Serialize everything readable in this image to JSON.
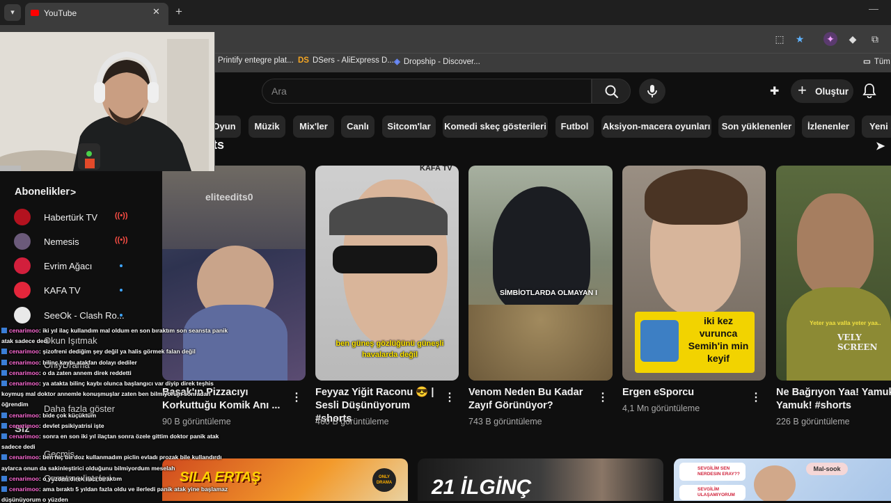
{
  "browser": {
    "tab_title": "YouTube",
    "tab_close": "✕",
    "new_tab": "+",
    "minimize": "—",
    "bookmarks": [
      {
        "icon": "",
        "label": "Printify entegre plat..."
      },
      {
        "icon": "DS",
        "label": "DSers - AliExpress D..."
      },
      {
        "icon": "◈",
        "label": "Dropship - Discover..."
      },
      {
        "icon": "▭",
        "label": "Tüm"
      }
    ]
  },
  "header": {
    "search_placeholder": "Ara",
    "create_label": "Oluştur"
  },
  "chips": [
    "Oyun",
    "Müzik",
    "Mix'ler",
    "Canlı",
    "Sitcom'lar",
    "Komedi skeç gösterileri",
    "Futbol",
    "Aksiyon-macera oyunları",
    "Son yüklenenler",
    "İzlenenler",
    "Yeni s"
  ],
  "section_heading": "ts",
  "sidebar": {
    "subscriptions_title": "Abonelikler",
    "subscriptions_chevron": ">",
    "subscriptions": [
      {
        "name": "Habertürk TV",
        "status": "live",
        "avatar_color": "#b3121f"
      },
      {
        "name": "Nemesis",
        "status": "live",
        "avatar_color": "#6b5a7a"
      },
      {
        "name": "Evrim Ağacı",
        "status": "new",
        "avatar_color": "#d21f3c"
      },
      {
        "name": "KAFA TV",
        "status": "new",
        "avatar_color": "#e3263b"
      },
      {
        "name": "SeeOk - Clash Ro...",
        "status": "new",
        "avatar_color": "#e9e9e9"
      }
    ],
    "ghost_items": [
      "Okun Işıtmak",
      "OnlyDrama",
      "Daha fazla göster",
      "Siz",
      "Geçmiş",
      "Oynatma listeleri"
    ]
  },
  "chat": [
    {
      "user": "cenarimoo",
      "text": ": iki yıl ilaç kullandım mal oldum en son bıraktım son seansta panik"
    },
    {
      "user": "",
      "text": "atak sadece dedi"
    },
    {
      "user": "cenarimoo",
      "text": ": şizofreni dediğim şey değil ya halis görmek falan değil"
    },
    {
      "user": "cenarimoo",
      "text": ": bilinç kaybı atakfan dolayı dediler"
    },
    {
      "user": "cenarimoo",
      "text": ": o da zaten annem direk reddetti"
    },
    {
      "user": "cenarimoo",
      "text": ": ya atakta bilinç kaybı olunca başlangıcı var diyip direk teşhis"
    },
    {
      "user": "",
      "text": "koymuş mal doktor annemle konuşmuşlar zaten ben bilmiyorum sonradan"
    },
    {
      "user": "",
      "text": "öğrendim"
    },
    {
      "user": "cenarimoo",
      "text": ": bide çok küçüktüm"
    },
    {
      "user": "cenarimoo",
      "text": ": devlet psikiyatrisi işte"
    },
    {
      "user": "cenarimoo",
      "text": ": sonra en son iki yıl ilaçtan sonra özele gittim doktor panik atak"
    },
    {
      "user": "",
      "text": "sadece dedi"
    },
    {
      "user": "cenarimoo",
      "text": ": ben hiç bir doz kullanmadım piclin evladı prozak bile kullandırdı"
    },
    {
      "user": "",
      "text": "aylarca onun da sakinleştirici olduğunu bilmiyordum meselah"
    },
    {
      "user": "cenarimoo",
      "text": ": o yüzden direk ilacı bıraktım"
    },
    {
      "user": "cenarimoo",
      "text": ": ama bıraktı 5 yıldan fazla oldu ve ilerledi panik atak yine başlamaz"
    },
    {
      "user": "",
      "text": "düşünüyorum o yüzden"
    }
  ],
  "videos": [
    {
      "title_line1": "Başak'ın Pizzacıyı",
      "title_line2": "Korkuttuğu Komik Anı ...",
      "views": "90 B görüntüleme",
      "overlay": "eliteedits0"
    },
    {
      "title_line1": "Feyyaz Yiğit Raconu 😎 |",
      "title_line2": "Sesli Düşünüyorum #shorts",
      "views": "460 B görüntüleme",
      "overlay": "ben güneş gözlüğünü güneşli havalarda değil",
      "badge": "KAFA TV"
    },
    {
      "title_line1": "Venom Neden Bu Kadar",
      "title_line2": "Zayıf Görünüyor?",
      "views": "743 B görüntüleme",
      "overlay": "SİMBİOTLARDA OLMAYAN I"
    },
    {
      "title_line1": "Ergen eSporcu",
      "title_line2": "",
      "views": "4,1 Mn görüntüleme",
      "overlay": "iki kez vurunca Semih'in min keyif"
    },
    {
      "title_line1": "Ne Bağrıyon Yaa! Yamuksa",
      "title_line2": "Yamuk! #shorts",
      "views": "226 B görüntüleme",
      "overlay": "Yeter yaa valla yeter yaa..",
      "badge": "VELY SCREEN"
    }
  ],
  "bottom_row": [
    {
      "overlay": "SILA ERTAŞ",
      "badge": "ONLY DRAMA"
    },
    {
      "overlay": "21 İLGİNÇ"
    },
    {
      "overlay": "SEVGİLİM SEN NERDESIN ERAY??",
      "overlay2": "SEVGİLİM ULAŞAMIYORUM",
      "badge": "Mal-sook"
    }
  ],
  "colors": {
    "background": "#0f0f0f",
    "chip": "#272727",
    "live": "#ff4e45",
    "new_dot": "#3ea6ff",
    "chat_user": "#ff6ad5"
  }
}
